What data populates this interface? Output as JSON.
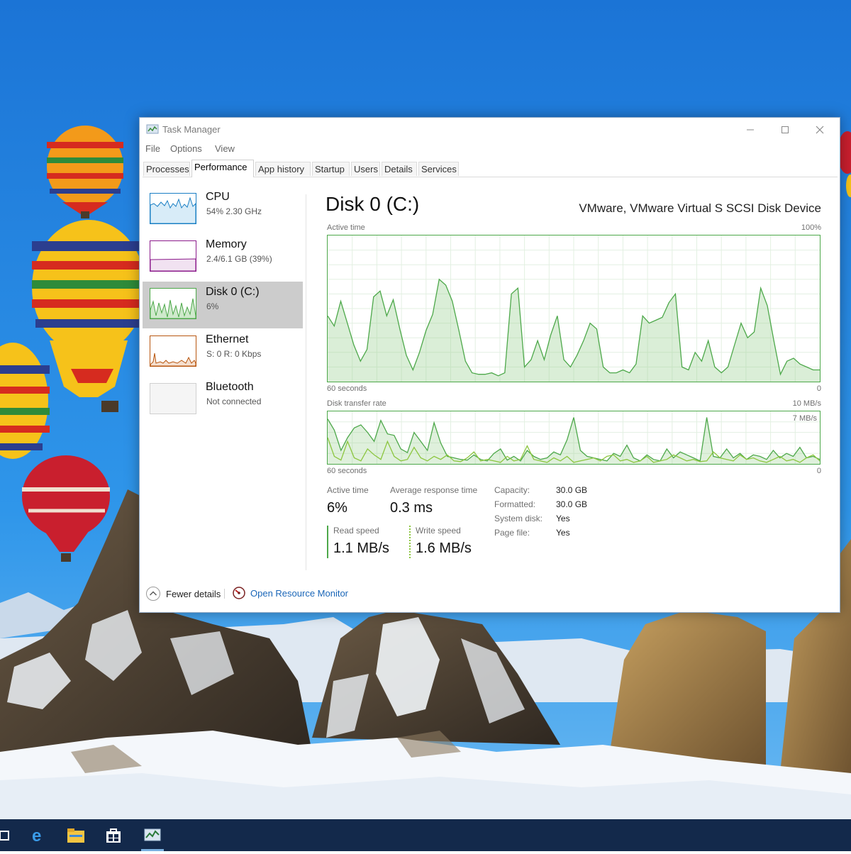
{
  "window": {
    "title": "Task Manager",
    "menu": [
      "File",
      "Options",
      "View"
    ],
    "tabs": [
      "Processes",
      "Performance",
      "App history",
      "Startup",
      "Users",
      "Details",
      "Services"
    ],
    "active_tab": "Performance"
  },
  "devices": [
    {
      "name": "CPU",
      "detail": "54% 2.30 GHz"
    },
    {
      "name": "Memory",
      "detail": "2.4/6.1 GB (39%)"
    },
    {
      "name": "Disk 0 (C:)",
      "detail": "6%"
    },
    {
      "name": "Ethernet",
      "detail": "S: 0 R: 0 Kbps"
    },
    {
      "name": "Bluetooth",
      "detail": "Not connected"
    }
  ],
  "selected_device": "Disk 0 (C:)",
  "main": {
    "title": "Disk 0 (C:)",
    "device": "VMware, VMware Virtual S SCSI Disk Device",
    "graph1": {
      "label": "Active time",
      "max": "100%",
      "time": "60 seconds",
      "min": "0"
    },
    "graph2": {
      "label": "Disk transfer rate",
      "max": "10 MB/s",
      "inner": "7 MB/s",
      "time": "60 seconds",
      "min": "0"
    }
  },
  "stats": {
    "active_time_label": "Active time",
    "active_time": "6%",
    "avg_resp_label": "Average response time",
    "avg_resp": "0.3 ms",
    "read_label": "Read speed",
    "read": "1.1 MB/s",
    "write_label": "Write speed",
    "write": "1.6 MB/s"
  },
  "props": [
    {
      "k": "Capacity:",
      "v": "30.0 GB"
    },
    {
      "k": "Formatted:",
      "v": "30.0 GB"
    },
    {
      "k": "System disk:",
      "v": "Yes"
    },
    {
      "k": "Page file:",
      "v": "Yes"
    }
  ],
  "footer": {
    "fewer": "Fewer details",
    "resmon": "Open Resource Monitor"
  },
  "active_time_series": [
    45,
    38,
    55,
    40,
    25,
    14,
    22,
    58,
    62,
    45,
    56,
    36,
    18,
    8,
    20,
    35,
    46,
    70,
    66,
    55,
    35,
    14,
    6,
    5,
    5,
    6,
    4,
    6,
    60,
    64,
    10,
    15,
    28,
    15,
    32,
    45,
    15,
    10,
    18,
    28,
    40,
    36,
    10,
    6,
    6,
    8,
    6,
    12,
    45,
    40,
    42,
    44,
    54,
    60,
    10,
    8,
    20,
    14,
    28,
    10,
    6,
    10,
    25,
    40,
    30,
    34,
    64,
    52,
    28,
    5,
    14,
    16,
    12,
    10,
    8,
    8
  ],
  "transfer_series_a": [
    60,
    45,
    18,
    35,
    48,
    52,
    42,
    30,
    58,
    40,
    38,
    20,
    15,
    42,
    30,
    18,
    55,
    28,
    10,
    8,
    6,
    5,
    12,
    6,
    4,
    14,
    20,
    5,
    10,
    4,
    18,
    10,
    6,
    8,
    16,
    12,
    32,
    62,
    18,
    10,
    8,
    6,
    4,
    14,
    10,
    25,
    8,
    4,
    12,
    6,
    4,
    20,
    8,
    16,
    12,
    8,
    4,
    62,
    10,
    8,
    20,
    8,
    14,
    6,
    12,
    10,
    6,
    18,
    8,
    14,
    10,
    22,
    8,
    10,
    6
  ],
  "transfer_series_b": [
    35,
    10,
    5,
    30,
    8,
    4,
    20,
    12,
    6,
    30,
    10,
    4,
    6,
    22,
    8,
    4,
    10,
    6,
    12,
    4,
    3,
    8,
    16,
    4,
    6,
    4,
    2,
    10,
    4,
    6,
    24,
    6,
    4,
    2,
    8,
    4,
    10,
    2,
    4,
    6,
    8,
    4,
    10,
    12,
    4,
    6,
    2,
    4,
    10,
    2,
    4,
    6,
    12,
    8,
    4,
    6,
    3,
    4,
    16,
    8,
    6,
    4,
    12,
    6,
    8,
    4,
    2,
    6,
    10,
    4,
    6,
    2,
    8,
    12,
    4
  ]
}
